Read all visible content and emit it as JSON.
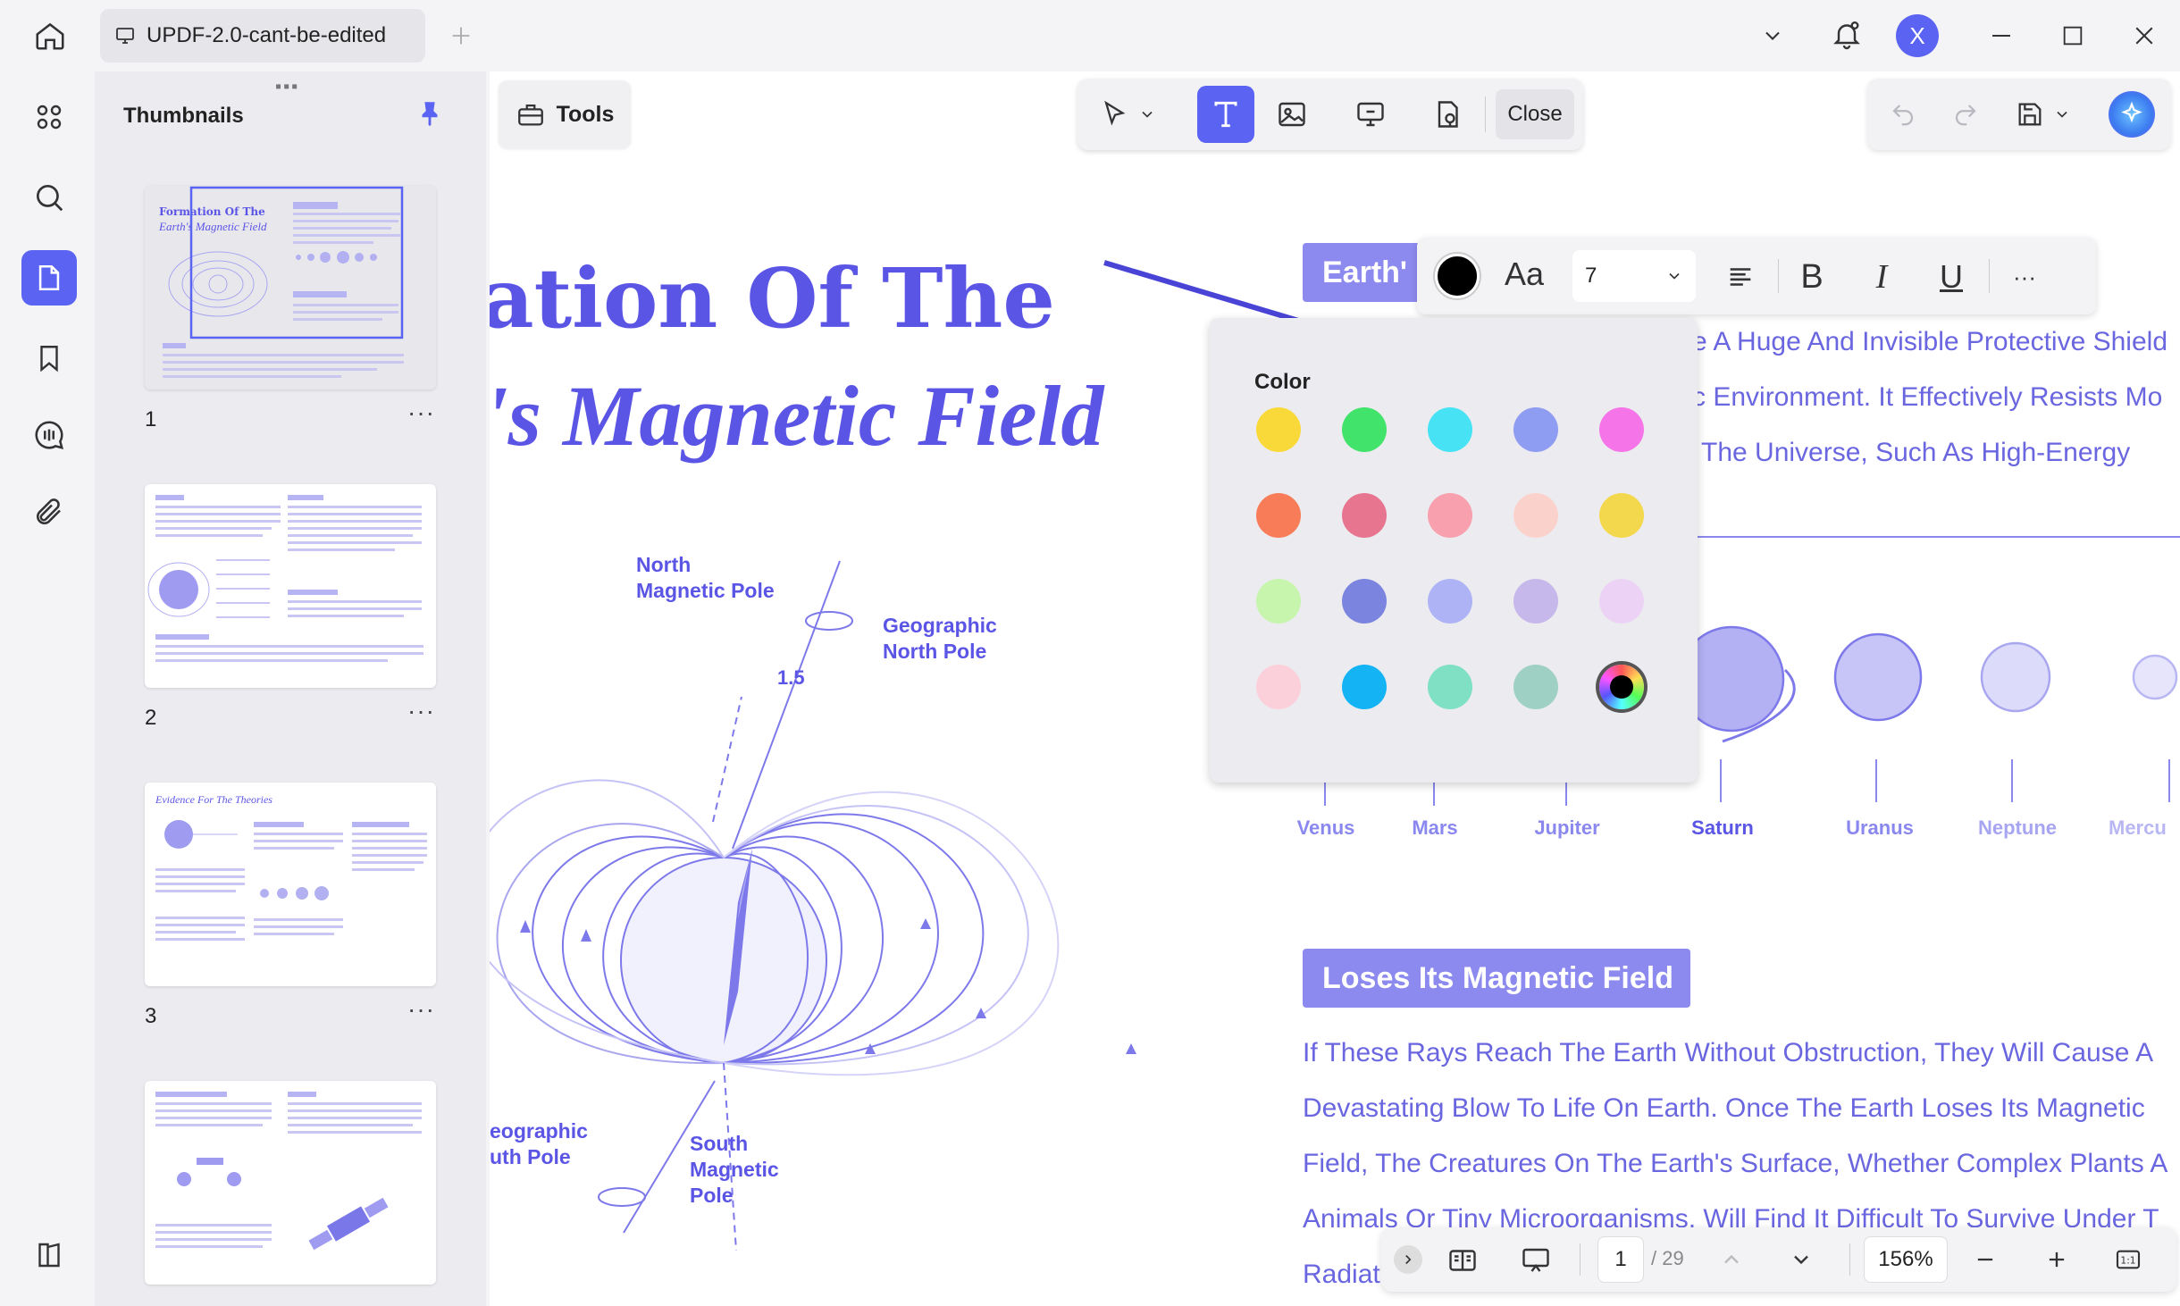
{
  "titlebar": {
    "tab_title": "UPDF-2.0-cant-be-edited",
    "avatar_letter": "X",
    "accent": "#5b63f2"
  },
  "left_rail": {
    "items": [
      "grid-icon",
      "search-icon",
      "page-icon",
      "bookmark-icon",
      "comment-icon",
      "attachment-icon",
      "sidebar-toggle-icon"
    ],
    "active": "page-icon"
  },
  "thumbnails": {
    "title": "Thumbnails",
    "pages": [
      {
        "number": "1",
        "heading_line1": "Formation Of The",
        "heading_line2": "Earth's Magnetic Field"
      },
      {
        "number": "2"
      },
      {
        "number": "3",
        "heading": "Evidence For The Theories"
      },
      {
        "number": ""
      }
    ]
  },
  "toolbar": {
    "tools_label": "Tools",
    "close_label": "Close"
  },
  "document": {
    "title_line1": "ation Of The",
    "title_line2": "'s Magnetic Field",
    "section_chip_1": "Earth'",
    "section_chip_2": "Loses Its Magnetic Field",
    "body_lines_top": [
      "e A Huge And Invisible Protective Shield",
      "c Environment. It Effectively Resists Mo",
      "The Universe, Such As High-Energy"
    ],
    "body_lines_bottom": [
      "If These Rays Reach The Earth Without Obstruction, They Will Cause A",
      "Devastating Blow To Life On Earth. Once The Earth Loses Its Magnetic",
      "Field, The Creatures On The Earth's Surface, Whether Complex Plants A",
      "Animals Or Tiny Microorganisms, Will Find It Difficult To Survive Under T",
      "Radiat"
    ],
    "diagram_labels": {
      "north_magnetic_pole": "North\nMagnetic Pole",
      "geographic_north_pole": "Geographic\nNorth Pole",
      "angle": "1.5",
      "geographic_south_pole": "eographic\nuth Pole",
      "south_magnetic_pole": "South\nMagnetic\nPole"
    },
    "planets": [
      "Venus",
      "Mars",
      "Jupiter",
      "Saturn",
      "Uranus",
      "Neptune",
      "Mercu"
    ]
  },
  "format_toolbar": {
    "font_label": "Aa",
    "font_size": "7",
    "current_color": "#000000"
  },
  "color_popup": {
    "title": "Color",
    "swatches": [
      [
        "#f9d93a",
        "#42e36a",
        "#47e3f5",
        "#8e9cf2",
        "#f574e8"
      ],
      [
        "#f77c57",
        "#e77590",
        "#f8a0ad",
        "#fbd2cb",
        "#f3d74d"
      ],
      [
        "#c8f5ad",
        "#7b85e0",
        "#aeb3f5",
        "#c6b8ea",
        "#ecd3f5"
      ],
      [
        "#fbd0da",
        "#14b4f4",
        "#7fe0c3",
        "#9ed1c3",
        "custom"
      ]
    ]
  },
  "bottom_bar": {
    "page_current": "1",
    "page_total": "/ 29",
    "zoom": "156%"
  }
}
